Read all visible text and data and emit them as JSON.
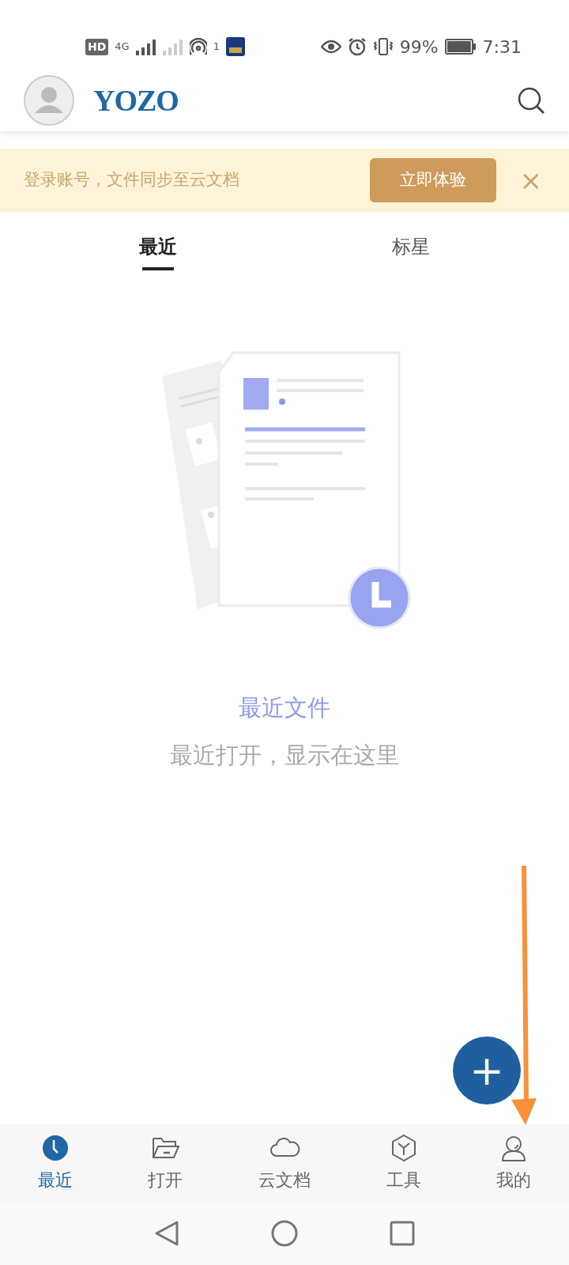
{
  "status_bar": {
    "hd": "HD",
    "network": "4G",
    "hotspot_count": "1",
    "battery_text": "99%",
    "battery": {
      "level": 0.99
    },
    "time": "7:31"
  },
  "header": {
    "logo": "YOZO"
  },
  "banner": {
    "text": "登录账号，文件同步至云文档",
    "button": "立即体验",
    "close": "×"
  },
  "tabs": [
    {
      "label": "最近",
      "selected": true
    },
    {
      "label": "标星",
      "selected": false
    }
  ],
  "empty_state": {
    "title": "最近文件",
    "subtitle": "最近打开，显示在这里"
  },
  "fab": {
    "label": "+"
  },
  "bottom_nav": [
    {
      "label": "最近",
      "selected": true
    },
    {
      "label": "打开",
      "selected": false
    },
    {
      "label": "云文档",
      "selected": false
    },
    {
      "label": "工具",
      "selected": false
    },
    {
      "label": "我的",
      "selected": false
    }
  ]
}
